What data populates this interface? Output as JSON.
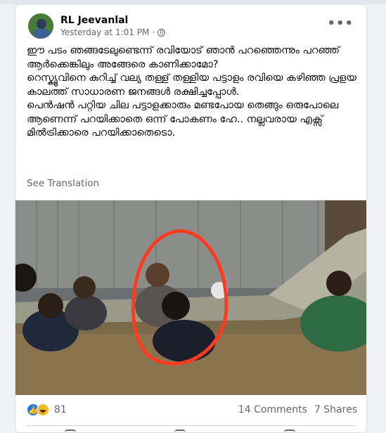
{
  "post": {
    "author": "RL Jeevanlal",
    "timestamp": "Yesterday at 1:01 PM",
    "separator": "·",
    "more_label": "•••",
    "paragraphs": [
      "ഈ പടം ഞങ്ങടേലുണ്ടെന്ന് രവിയോട് ഞാൻ പറഞ്ഞെന്നും പറഞ്ഞ് ആർക്കെങ്കിലും അങ്ങേരെ കാണിക്കാമോ?",
      "റെസ്ക്യൂവിനെ കുറിച്ച് വല്യ തള്ള് തള്ളിയ പട്ടാളം രവിയെ കഴിഞ്ഞ പ്രളയ കാലത്ത് സാധാരണ ജനങ്ങൾ രക്ഷിച്ചപ്പോൾ.",
      "പെൻഷൻ പറ്റിയ ചില പട്ടാളക്കാരും മണ്ടപോയ തെങ്ങും ഒരുപോലെ ആണെന്ന് പറയിക്കാതെ ഒന്ന് പോകണം ഹേ.. നല്ലവരായ എക്സ് മിൽട്രിക്കാരെ പറയിക്കാതെടൊ."
    ],
    "see_translation": "See Translation",
    "reaction_count": "81",
    "comments": "14 Comments",
    "shares": "7 Shares"
  },
  "icons": {
    "avatar": "profile-photo",
    "globe": "globe-icon",
    "like": "like-reaction-icon",
    "haha": "haha-reaction-icon"
  },
  "colors": {
    "accent": "#1877f2",
    "circle": "#ff3b1f",
    "water": "#7a6a4a"
  }
}
